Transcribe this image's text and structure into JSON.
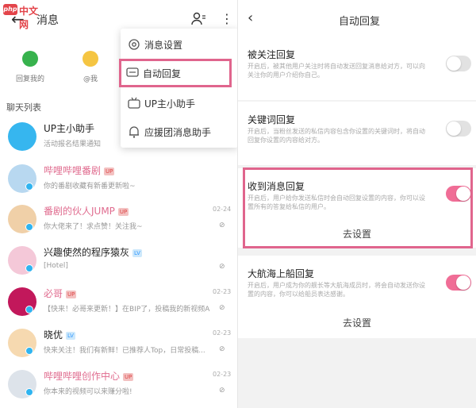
{
  "watermark": {
    "logo": "php",
    "text": "中文网"
  },
  "left": {
    "title": "消息",
    "quick": [
      {
        "label": "回复我的",
        "color": "#37b24d"
      },
      {
        "label": "@我",
        "color": "#f5c542"
      }
    ],
    "section_label": "聊天列表",
    "chats": [
      {
        "name": "UP主小助手",
        "pink": false,
        "tag": "",
        "tag_type": "",
        "msg": "活动报名结果通知",
        "time": "",
        "mute": "",
        "avatar_color": "#36b6ef"
      },
      {
        "name": "哔哩哔哩番剧",
        "pink": true,
        "tag": "UP",
        "tag_type": "up",
        "msg": "你的番剧收藏有新番更新啦~",
        "time": "",
        "mute": "",
        "avatar_color": "#b8d8f0"
      },
      {
        "name": "番剧的伙人JUMP",
        "pink": true,
        "tag": "UP",
        "tag_type": "up",
        "msg": "你大佬来了！求点赞！关注我~",
        "time": "02-24",
        "mute": "⊘",
        "avatar_color": "#f0d0a8"
      },
      {
        "name": "兴趣使然的程序猿灰",
        "pink": false,
        "tag": "LV",
        "tag_type": "lv",
        "msg": "[Hotel]",
        "time": "",
        "mute": "⊘",
        "avatar_color": "#f4c8d8"
      },
      {
        "name": "必哥",
        "pink": true,
        "tag": "UP",
        "tag_type": "up",
        "msg": "【快来！必哥来更新！】在BIP了，投稿我的新视频A...",
        "time": "02-23",
        "mute": "⊘",
        "avatar_color": "#c2185b"
      },
      {
        "name": "晓优",
        "pink": false,
        "tag": "LV",
        "tag_type": "lv",
        "msg": "快来关注！我们有新鲜！已推荐人Top，日常投稿...",
        "time": "02-23",
        "mute": "⊘",
        "avatar_color": "#f6d9b0"
      },
      {
        "name": "哔哩哔哩创作中心",
        "pink": true,
        "tag": "UP",
        "tag_type": "up",
        "msg": "你本来的视频可以来赚分啦!",
        "time": "02-23",
        "mute": "⊘",
        "avatar_color": "#dde3ea"
      }
    ],
    "menu": [
      {
        "label": "消息设置",
        "icon": "gear-icon"
      },
      {
        "label": "自动回复",
        "icon": "chat-bubble-icon"
      },
      {
        "label": "UP主小助手",
        "icon": "tv-icon"
      },
      {
        "label": "应援团消息助手",
        "icon": "bell-icon"
      }
    ]
  },
  "right": {
    "title": "自动回复",
    "sections": [
      {
        "title": "被关注回复",
        "desc": "开启后，被其他用户关注时将自动发送回复消息给对方，可以向关注你的用户介绍你自己。",
        "on": false
      },
      {
        "title": "关键词回复",
        "desc": "开启后，当粉丝发送的私信内容包含你设置的关键词时，将自动回复你设置的内容给对方。",
        "on": false
      },
      {
        "title": "收到消息回复",
        "desc": "开启后，用户给你发送私信时会自动回复设置的内容，你可以设置所有的答复给私信的用户。",
        "on": true,
        "action": "去设置"
      },
      {
        "title": "大航海上船回复",
        "desc": "开启后，用户成为你的舰长等大航海成员时，将会自动发送你设置的内容，你可以给船员表达感谢。",
        "on": true,
        "action": "去设置"
      }
    ],
    "colors": {
      "accent": "#f06d96",
      "highlight": "#e0658d"
    }
  }
}
